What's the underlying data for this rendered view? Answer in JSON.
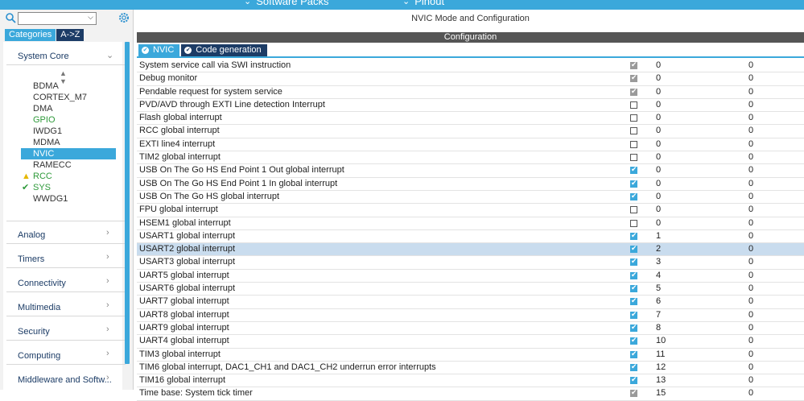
{
  "top_menu": [
    {
      "label": "Software Packs",
      "icon": "chevron-down-icon"
    },
    {
      "label": "Pinout",
      "icon": "chevron-down-icon"
    }
  ],
  "left_panel": {
    "search": {
      "value": "",
      "placeholder": ""
    },
    "tabs": [
      "Categories",
      "A->Z"
    ],
    "active_tab": "A->Z",
    "system_core": {
      "label": "System Core",
      "items": [
        {
          "label": "BDMA",
          "state": ""
        },
        {
          "label": "CORTEX_M7",
          "state": ""
        },
        {
          "label": "DMA",
          "state": ""
        },
        {
          "label": "GPIO",
          "state": "green"
        },
        {
          "label": "IWDG1",
          "state": ""
        },
        {
          "label": "MDMA",
          "state": ""
        },
        {
          "label": "NVIC",
          "state": "selected"
        },
        {
          "label": "RAMECC",
          "state": ""
        },
        {
          "label": "RCC",
          "state": "warning"
        },
        {
          "label": "SYS",
          "state": "check"
        },
        {
          "label": "WWDG1",
          "state": ""
        }
      ]
    },
    "categories": [
      {
        "label": "Analog"
      },
      {
        "label": "Timers"
      },
      {
        "label": "Connectivity"
      },
      {
        "label": "Multimedia"
      },
      {
        "label": "Security"
      },
      {
        "label": "Computing"
      },
      {
        "label": "Middleware and Softw..."
      }
    ]
  },
  "main": {
    "title": "NVIC Mode and Configuration",
    "config_label": "Configuration",
    "tabs": [
      {
        "label": "NVIC",
        "active": false
      },
      {
        "label": "Code generation",
        "active": true
      }
    ],
    "rows": [
      {
        "name": "System service call via SWI instruction",
        "enabled": "disabled",
        "prio": "0",
        "sub": "0"
      },
      {
        "name": "Debug monitor",
        "enabled": "disabled",
        "prio": "0",
        "sub": "0"
      },
      {
        "name": "Pendable request for system service",
        "enabled": "disabled",
        "prio": "0",
        "sub": "0"
      },
      {
        "name": "PVD/AVD through EXTI Line detection Interrupt",
        "enabled": "off",
        "prio": "0",
        "sub": "0"
      },
      {
        "name": "Flash global interrupt",
        "enabled": "off",
        "prio": "0",
        "sub": "0"
      },
      {
        "name": "RCC global interrupt",
        "enabled": "off",
        "prio": "0",
        "sub": "0"
      },
      {
        "name": "EXTI line4 interrupt",
        "enabled": "off",
        "prio": "0",
        "sub": "0"
      },
      {
        "name": "TIM2 global interrupt",
        "enabled": "off",
        "prio": "0",
        "sub": "0"
      },
      {
        "name": "USB On The Go HS End Point 1 Out global interrupt",
        "enabled": "on",
        "prio": "0",
        "sub": "0"
      },
      {
        "name": "USB On The Go HS End Point 1 In global interrupt",
        "enabled": "on",
        "prio": "0",
        "sub": "0"
      },
      {
        "name": "USB On The Go HS global interrupt",
        "enabled": "on",
        "prio": "0",
        "sub": "0"
      },
      {
        "name": "FPU global interrupt",
        "enabled": "off",
        "prio": "0",
        "sub": "0"
      },
      {
        "name": "HSEM1 global interrupt",
        "enabled": "off",
        "prio": "0",
        "sub": "0"
      },
      {
        "name": "USART1 global interrupt",
        "enabled": "on",
        "prio": "1",
        "sub": "0"
      },
      {
        "name": "USART2 global interrupt",
        "enabled": "on",
        "prio": "2",
        "sub": "0",
        "highlight": true
      },
      {
        "name": "USART3 global interrupt",
        "enabled": "on",
        "prio": "3",
        "sub": "0"
      },
      {
        "name": "UART5 global interrupt",
        "enabled": "on",
        "prio": "4",
        "sub": "0"
      },
      {
        "name": "USART6 global interrupt",
        "enabled": "on",
        "prio": "5",
        "sub": "0"
      },
      {
        "name": "UART7 global interrupt",
        "enabled": "on",
        "prio": "6",
        "sub": "0"
      },
      {
        "name": "UART8 global interrupt",
        "enabled": "on",
        "prio": "7",
        "sub": "0"
      },
      {
        "name": "UART9 global interrupt",
        "enabled": "on",
        "prio": "8",
        "sub": "0"
      },
      {
        "name": "UART4 global interrupt",
        "enabled": "on",
        "prio": "10",
        "sub": "0"
      },
      {
        "name": "TIM3 global interrupt",
        "enabled": "on",
        "prio": "11",
        "sub": "0"
      },
      {
        "name": "TIM6 global interrupt, DAC1_CH1 and DAC1_CH2 underrun error interrupts",
        "enabled": "on",
        "prio": "12",
        "sub": "0"
      },
      {
        "name": "TIM16 global interrupt",
        "enabled": "on",
        "prio": "13",
        "sub": "0"
      },
      {
        "name": "Time base: System tick timer",
        "enabled": "disabled",
        "prio": "15",
        "sub": "0"
      }
    ]
  },
  "colors": {
    "accent": "#3ba8db",
    "dark": "#1c3c66",
    "highlight": "#c9dcee",
    "ok": "#2e9a3a",
    "warn": "#f1c40f"
  }
}
